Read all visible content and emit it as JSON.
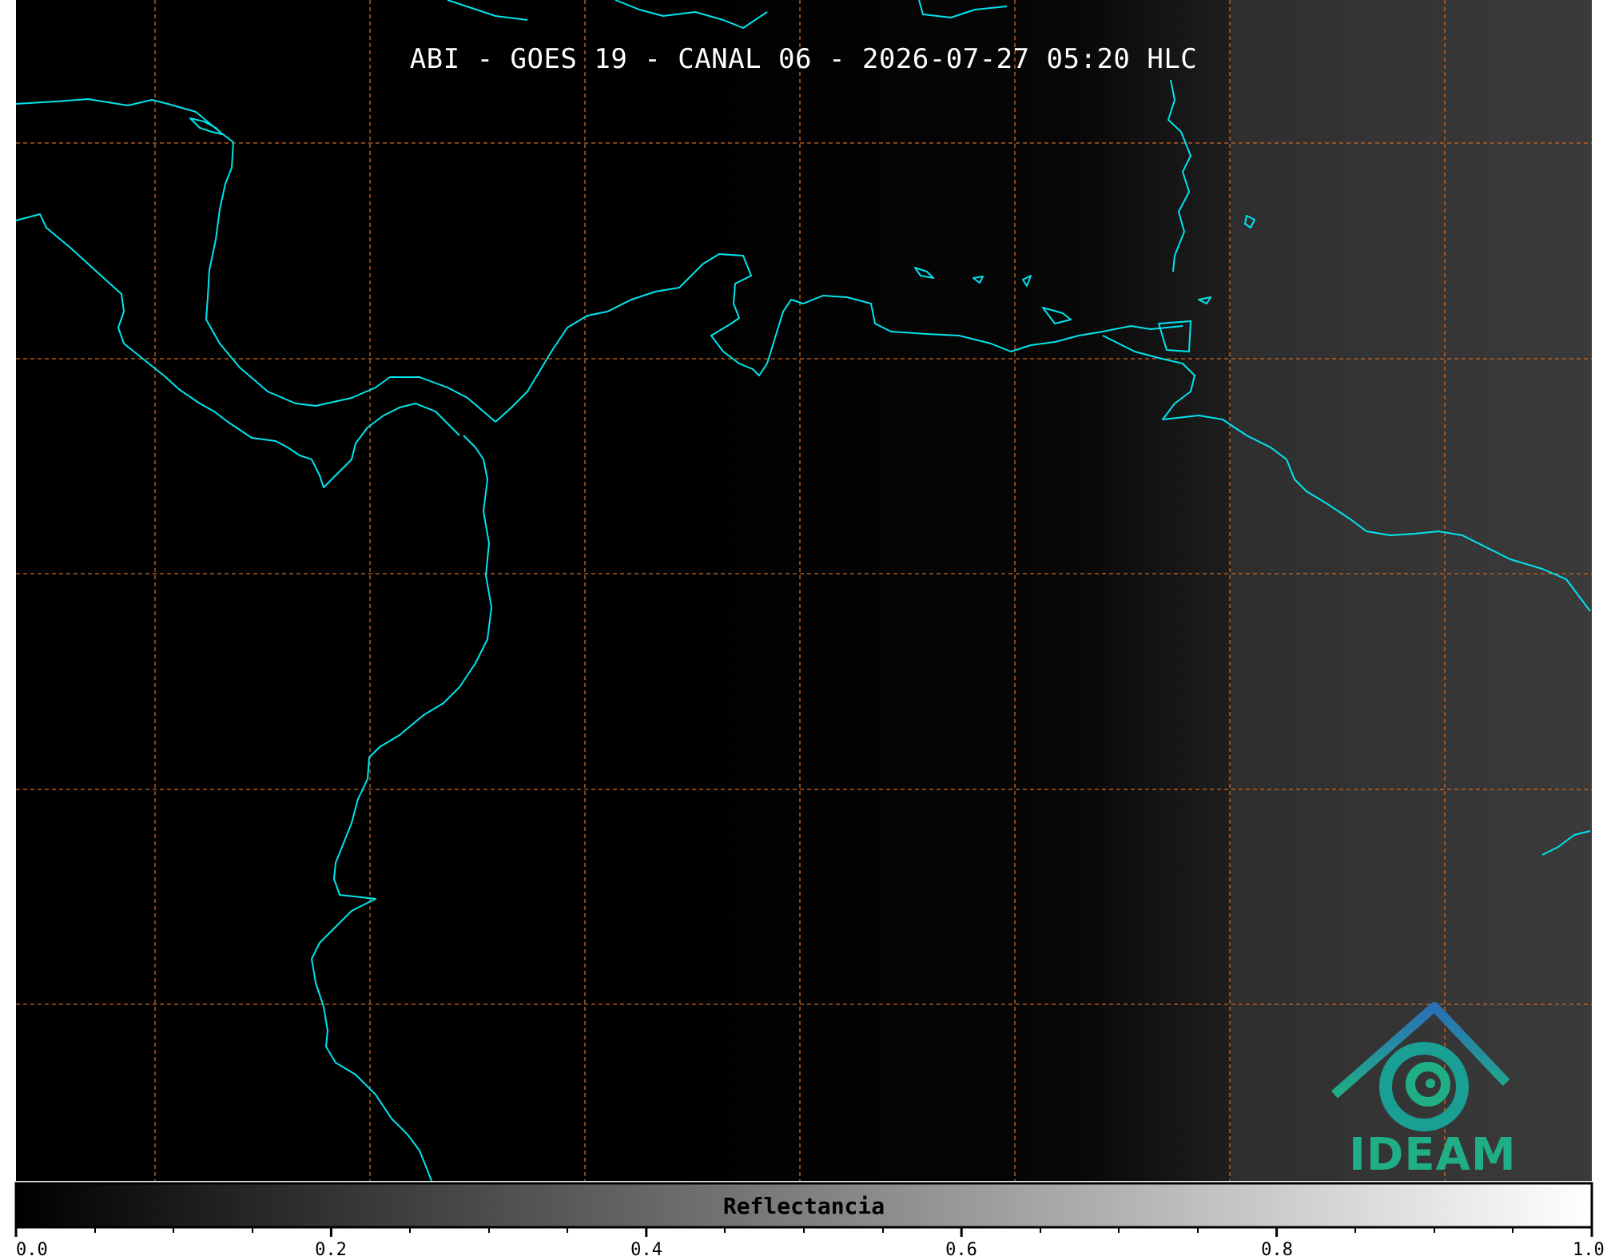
{
  "title": "ABI - GOES 19 - CANAL 06 - 2026-07-27 05:20 HLC",
  "logo": {
    "text": "IDEAM",
    "color": "#1fae86",
    "icon": "ideam-spiral-house-icon"
  },
  "colorbar": {
    "label": "Reflectancia",
    "min": 0.0,
    "max": 1.0,
    "tick_labels": [
      "0.0",
      "0.2",
      "0.4",
      "0.6",
      "0.8",
      "1.0"
    ],
    "colormap": [
      "#000000",
      "#ffffff"
    ]
  },
  "colors": {
    "coastline": "#00e5ee",
    "gridlines": "#d2691e",
    "background": "#000000"
  }
}
